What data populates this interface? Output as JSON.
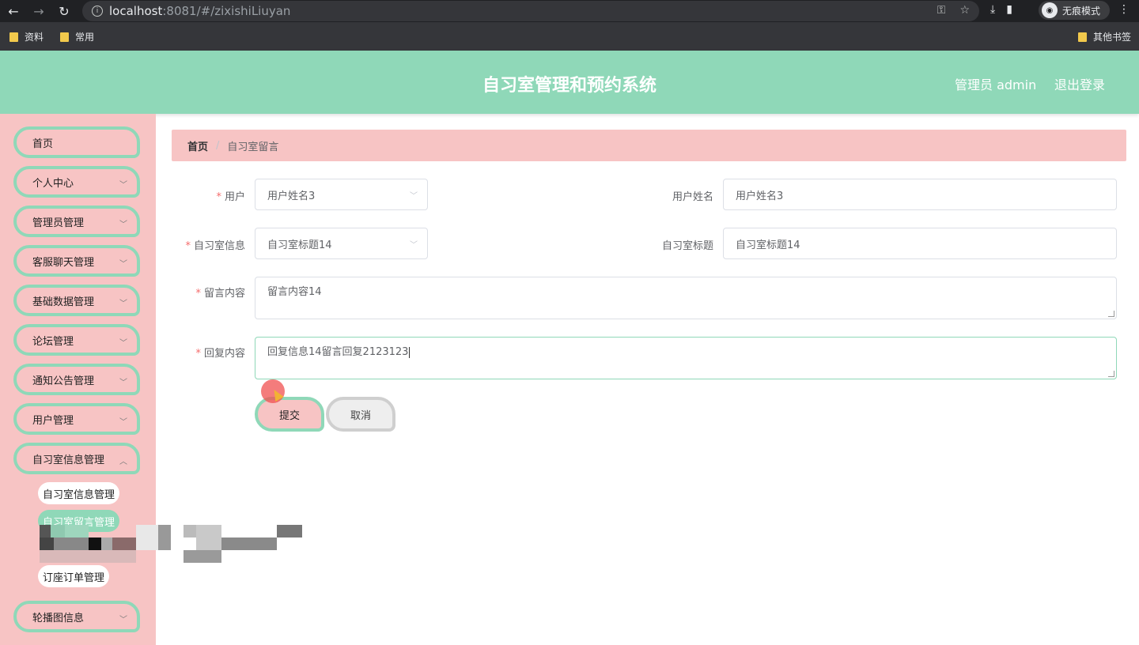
{
  "browser": {
    "url_host": "localhost",
    "url_rest": ":8081/#/zixishiLiuyan",
    "incognito_label": "无痕模式",
    "bookmarks": [
      "资料",
      "常用"
    ],
    "other_bookmarks": "其他书签"
  },
  "header": {
    "title": "自习室管理和预约系统",
    "admin": "管理员 admin",
    "logout": "退出登录"
  },
  "sidebar": {
    "items": [
      "首页",
      "个人中心",
      "管理员管理",
      "客服聊天管理",
      "基础数据管理",
      "论坛管理",
      "通知公告管理",
      "用户管理",
      "自习室信息管理"
    ],
    "sub_items": [
      "自习室信息管理",
      "自习室留言管理",
      "订座订单管理"
    ],
    "last_item": "轮播图信息"
  },
  "breadcrumb": {
    "home": "首页",
    "current": "自习室留言"
  },
  "form": {
    "user_label": "用户",
    "user_value": "用户姓名3",
    "user_name_label": "用户姓名",
    "user_name_value": "用户姓名3",
    "room_label": "自习室信息",
    "room_value": "自习室标题14",
    "room_title_label": "自习室标题",
    "room_title_value": "自习室标题14",
    "message_label": "留言内容",
    "message_value": "留言内容14",
    "reply_label": "回复内容",
    "reply_value": "回复信息14留言回复2123123",
    "required_mark": "*",
    "submit": "提交",
    "cancel": "取消"
  }
}
